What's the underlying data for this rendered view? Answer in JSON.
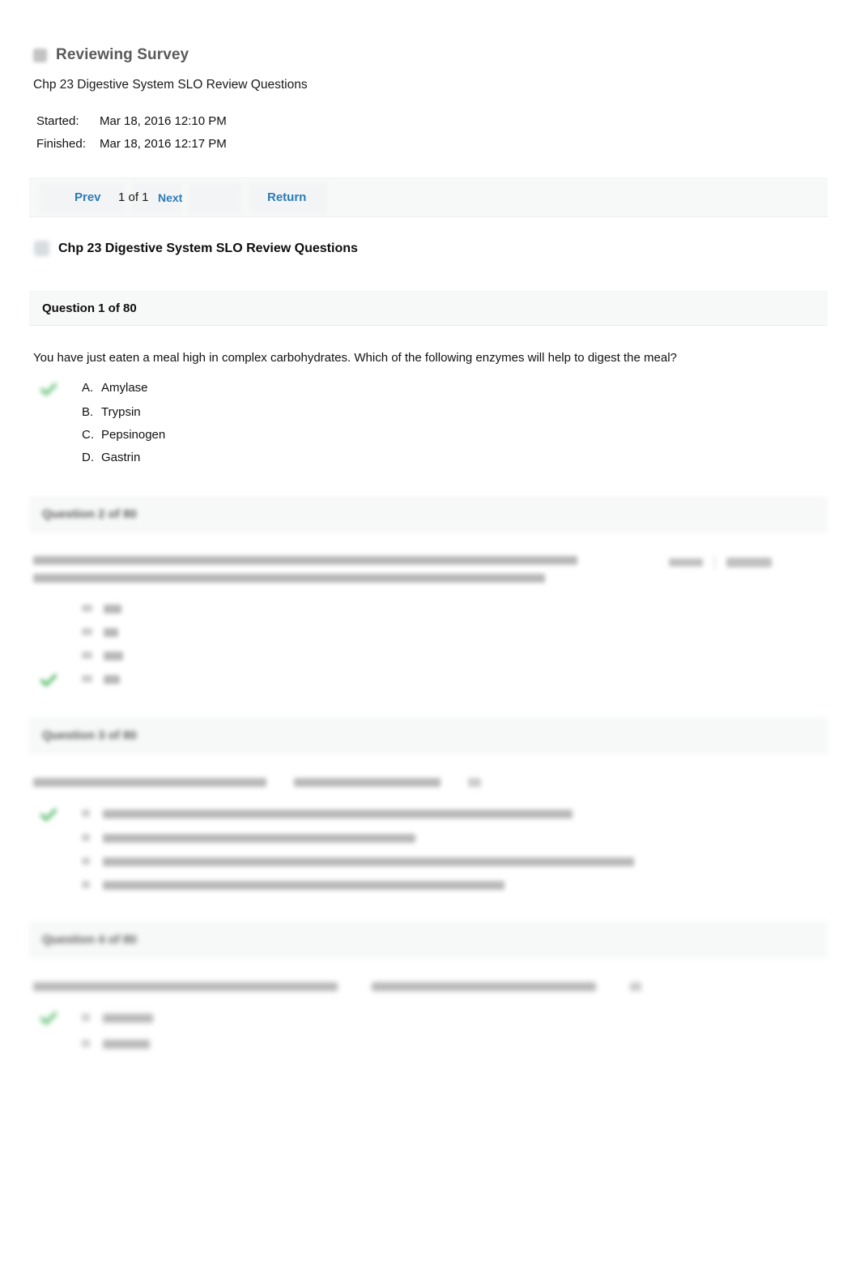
{
  "header": {
    "icon": "survey-icon",
    "title": "Reviewing Survey",
    "subtitle": "Chp 23 Digestive System SLO Review Questions"
  },
  "timing": {
    "started_label": "Started:",
    "started_value": "Mar 18, 2016 12:10 PM",
    "finished_label": "Finished:",
    "finished_value": "Mar 18, 2016 12:17 PM"
  },
  "nav": {
    "prev_label": "Prev",
    "counter": "1 of 1",
    "next_label": "Next",
    "return_label": "Return",
    "link_color": "#2b7cb8"
  },
  "quiz": {
    "icon": "quiz-icon",
    "title": "Chp 23 Digestive System SLO Review Questions"
  },
  "correct_marker_color": "#8fd49a",
  "questions": [
    {
      "header": "Question 1 of 80",
      "text": "You have just eaten a meal high in complex carbohydrates.  Which of the following enzymes will help to digest the meal?",
      "blurred": false,
      "options": [
        {
          "letter": "A.",
          "text": "Amylase",
          "correct": true
        },
        {
          "letter": "B.",
          "text": "Trypsin",
          "correct": false
        },
        {
          "letter": "C.",
          "text": "Pepsinogen",
          "correct": false
        },
        {
          "letter": "D.",
          "text": "Gastrin",
          "correct": false
        }
      ]
    },
    {
      "header": "Question 2 of 80",
      "text": "",
      "blurred": true,
      "option_count": 4,
      "correct_index": 3
    },
    {
      "header": "Question 3 of 80",
      "text": "",
      "blurred": true,
      "option_count": 4,
      "correct_index": 0
    },
    {
      "header": "Question 4 of 80",
      "text": "",
      "blurred": true,
      "option_count": 2,
      "correct_index": 0
    }
  ]
}
